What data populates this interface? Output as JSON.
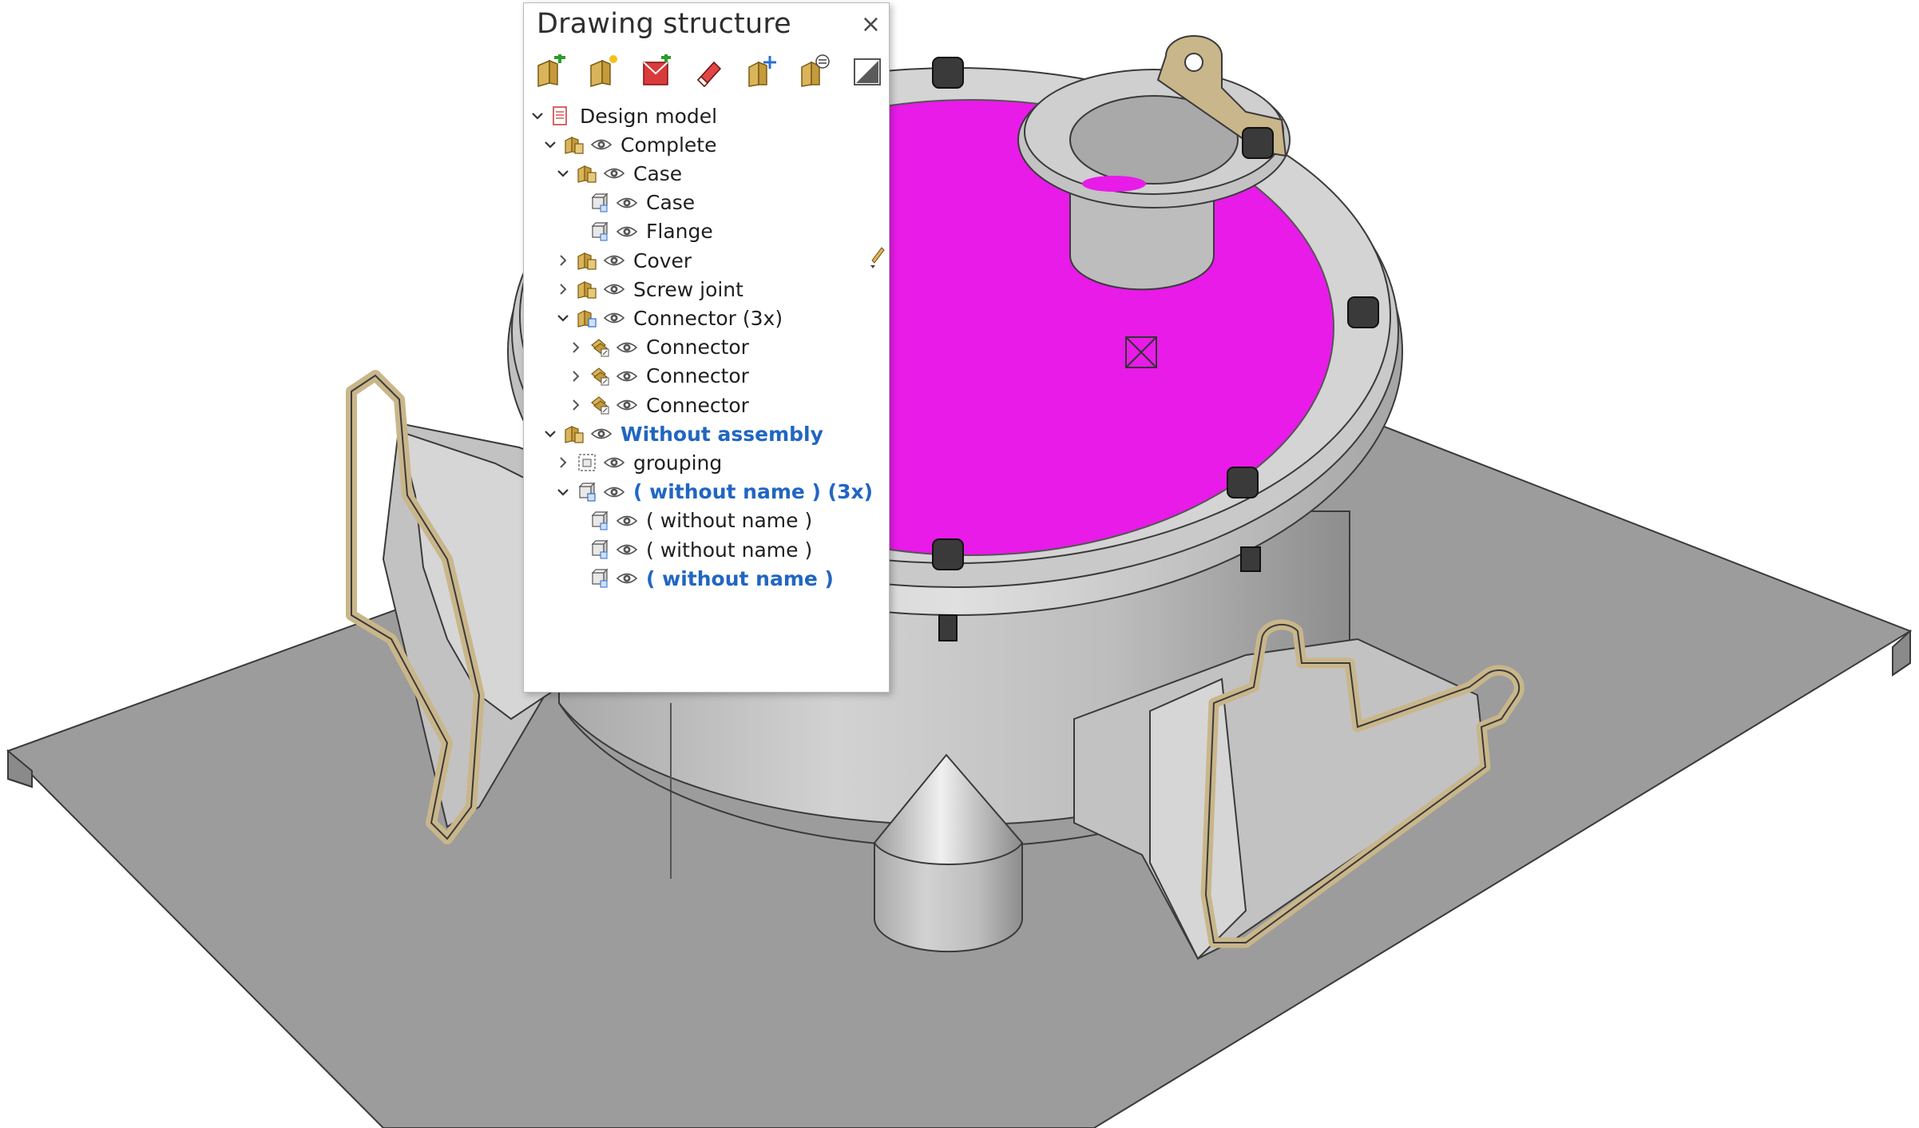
{
  "panel": {
    "title": "Drawing structure",
    "close": "×",
    "toolbar": [
      {
        "icon": "new-assembly-icon"
      },
      {
        "icon": "new-part-icon"
      },
      {
        "icon": "add-sheet-icon"
      },
      {
        "icon": "eraser-icon"
      },
      {
        "icon": "move-assembly-icon"
      },
      {
        "icon": "swap-assembly-icon"
      },
      {
        "icon": "shading-toggle-icon"
      }
    ],
    "tree": [
      {
        "label": "Design model",
        "level": 0,
        "expanded": true,
        "icon": "document-icon",
        "eye": false,
        "highlight": false
      },
      {
        "label": "Complete",
        "level": 1,
        "expanded": true,
        "icon": "assembly-icon",
        "eye": true,
        "highlight": false
      },
      {
        "label": "Case",
        "level": 2,
        "expanded": true,
        "icon": "assembly-icon",
        "eye": true,
        "highlight": false
      },
      {
        "label": "Case",
        "level": 3,
        "expanded": null,
        "icon": "part-icon",
        "eye": true,
        "highlight": false
      },
      {
        "label": "Flange",
        "level": 3,
        "expanded": null,
        "icon": "part-icon",
        "eye": true,
        "highlight": false
      },
      {
        "label": "Cover",
        "level": 2,
        "expanded": false,
        "icon": "assembly-icon",
        "eye": true,
        "highlight": false
      },
      {
        "label": "Screw joint",
        "level": 2,
        "expanded": false,
        "icon": "assembly-icon",
        "eye": true,
        "highlight": false
      },
      {
        "label": "Connector (3x)",
        "level": 2,
        "expanded": true,
        "icon": "assembly-multi-icon",
        "eye": true,
        "highlight": false
      },
      {
        "label": "Connector",
        "level": 3,
        "expanded": false,
        "icon": "connector-icon",
        "eye": true,
        "highlight": false
      },
      {
        "label": "Connector",
        "level": 3,
        "expanded": false,
        "icon": "connector-icon",
        "eye": true,
        "highlight": false
      },
      {
        "label": "Connector",
        "level": 3,
        "expanded": false,
        "icon": "connector-icon",
        "eye": true,
        "highlight": false
      },
      {
        "label": "Without assembly",
        "level": 1,
        "expanded": true,
        "icon": "assembly-icon",
        "eye": true,
        "highlight": true
      },
      {
        "label": "grouping",
        "level": 2,
        "expanded": false,
        "icon": "grouping-icon",
        "eye": true,
        "highlight": false
      },
      {
        "label": "( without name ) (3x)",
        "level": 2,
        "expanded": true,
        "icon": "part-multi-icon",
        "eye": true,
        "highlight": true
      },
      {
        "label": "( without name )",
        "level": 3,
        "expanded": null,
        "icon": "part-icon",
        "eye": true,
        "highlight": false
      },
      {
        "label": "( without name )",
        "level": 3,
        "expanded": null,
        "icon": "part-icon",
        "eye": true,
        "highlight": false
      },
      {
        "label": "( without name )",
        "level": 3,
        "expanded": null,
        "icon": "part-icon",
        "eye": true,
        "highlight": true
      }
    ]
  },
  "colors": {
    "accent_text": "#2166c2",
    "cover_face": "#e81be8",
    "brass": "#c9b68a",
    "metal": "#c8c8c8",
    "plate": "#9a9a9a"
  }
}
